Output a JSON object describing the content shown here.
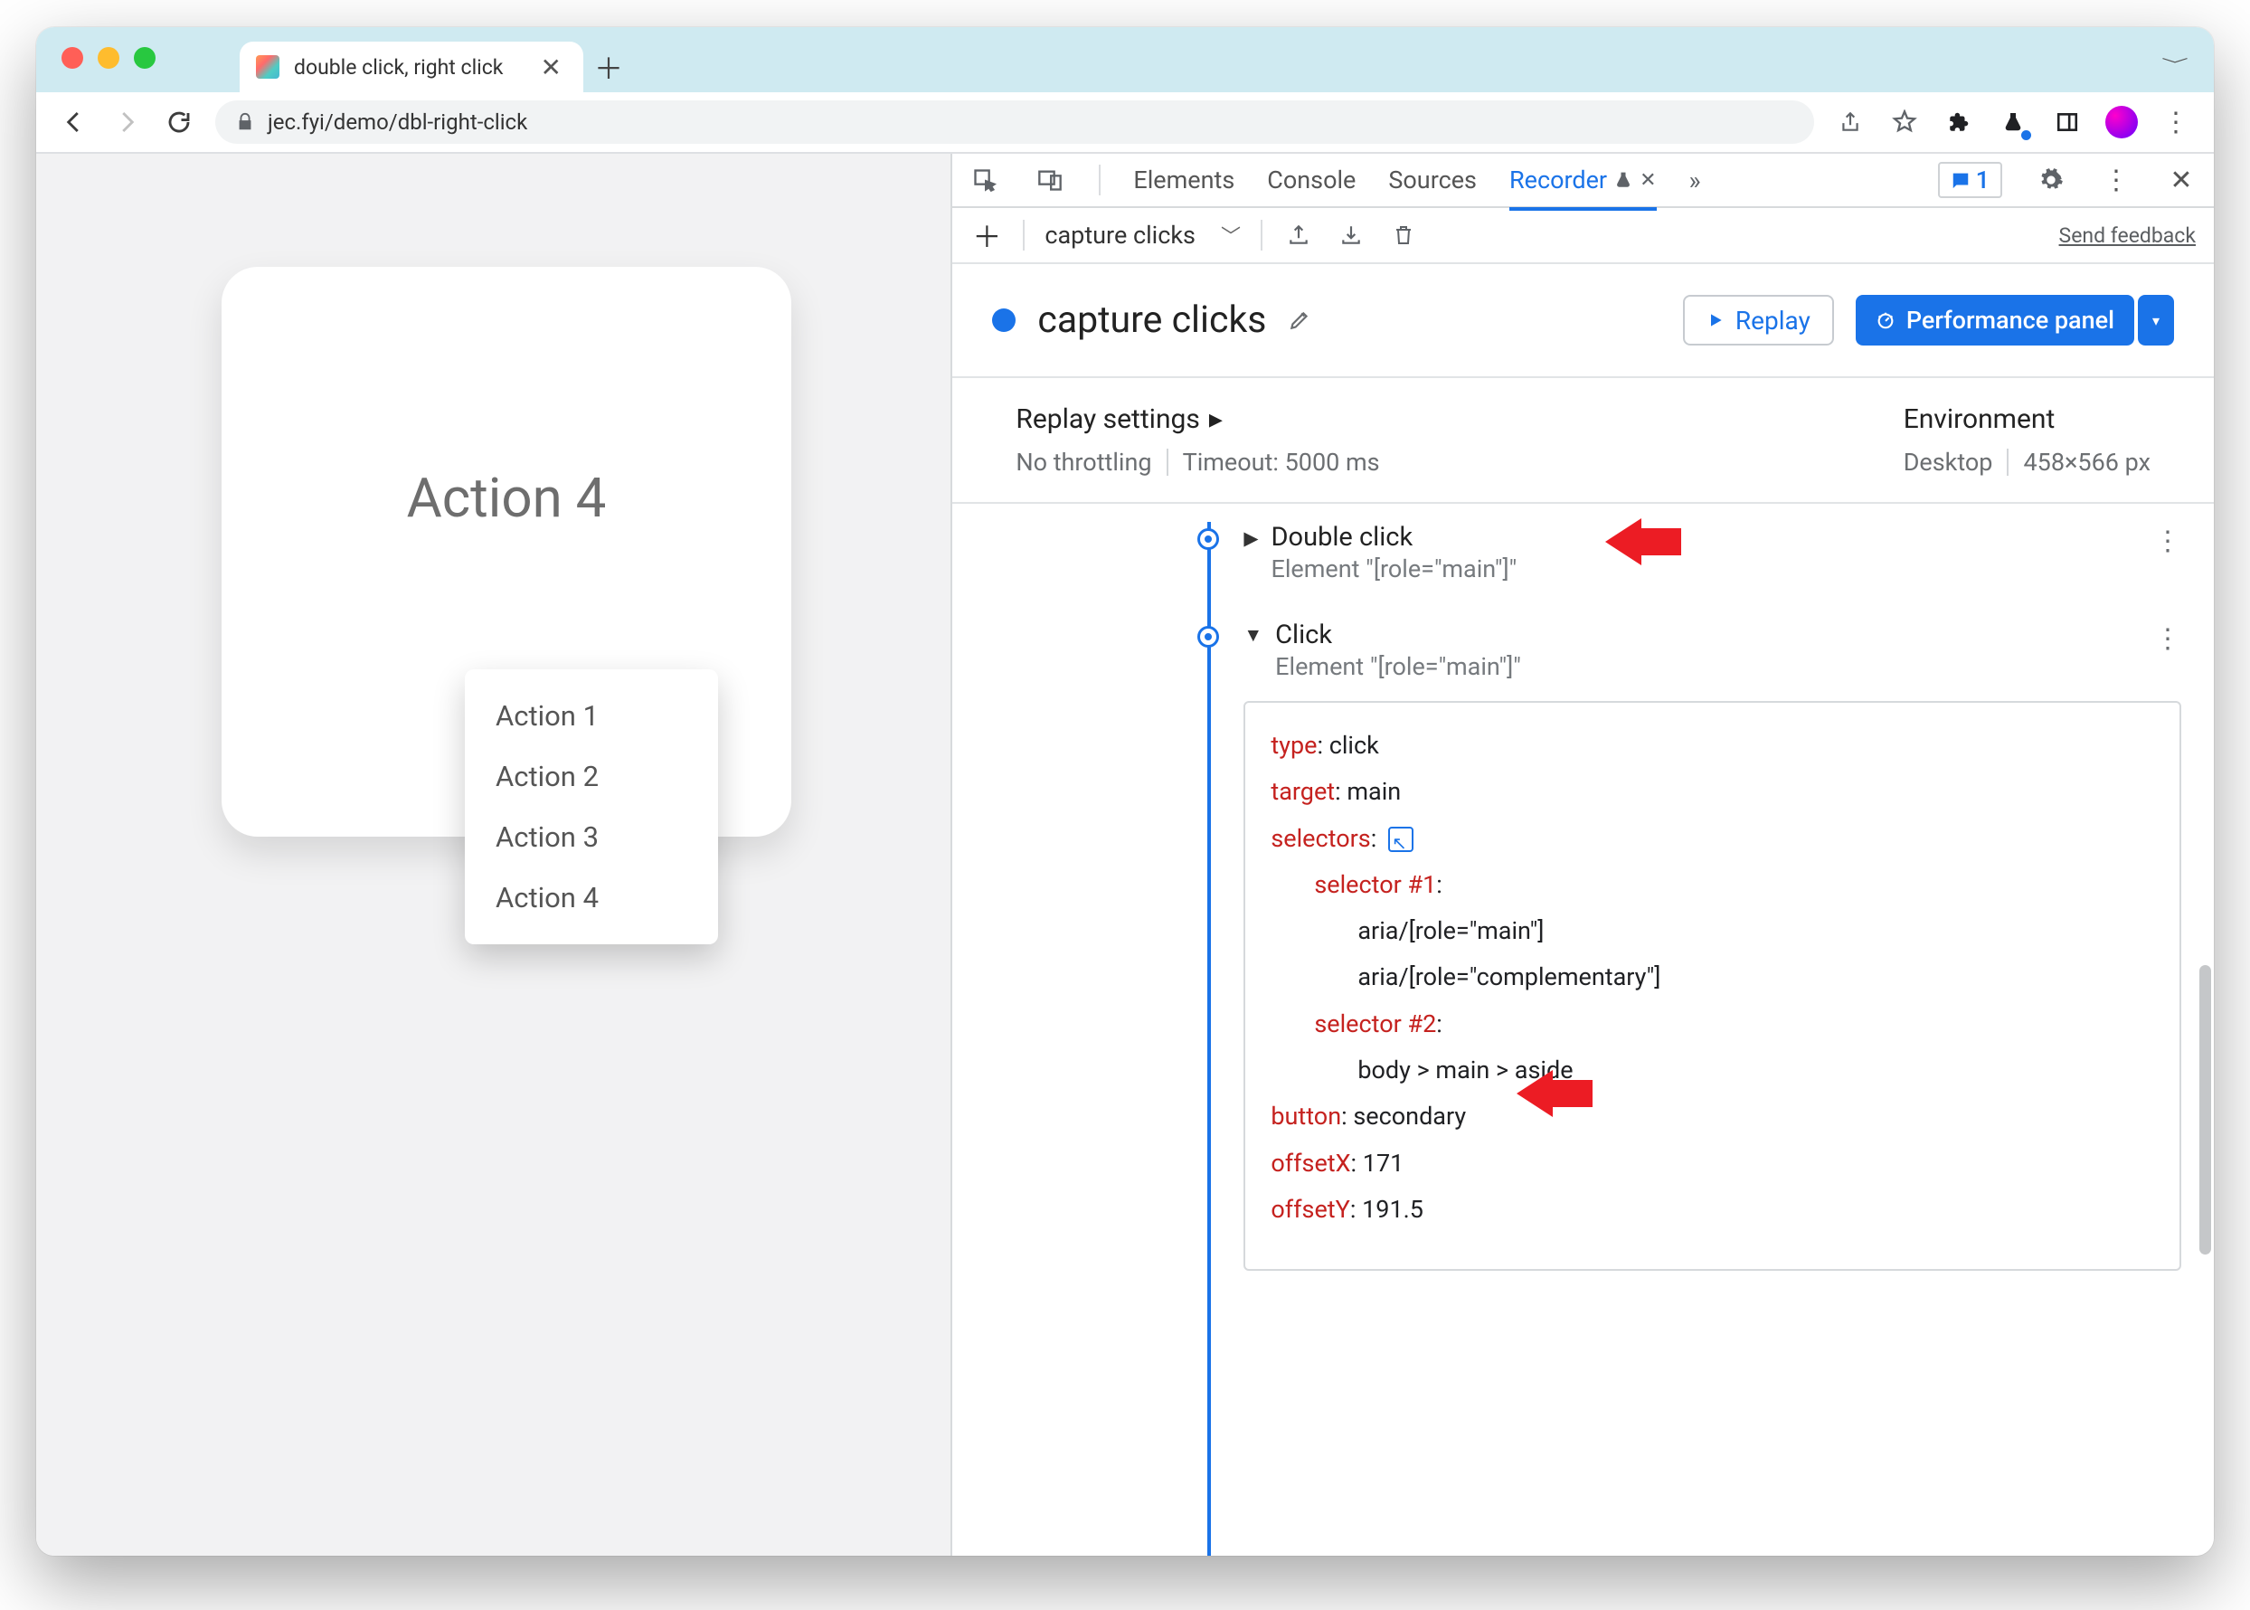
{
  "window": {
    "traffic_colors": [
      "#ff5f57",
      "#febc2e",
      "#28c840"
    ]
  },
  "tab": {
    "title": "double click, right click"
  },
  "toolbar": {
    "url_display": "jec.fyi/demo/dbl-right-click"
  },
  "page": {
    "card_title": "Action 4",
    "context_menu": [
      "Action 1",
      "Action 2",
      "Action 3",
      "Action 4"
    ]
  },
  "devtools": {
    "tabs": [
      "Elements",
      "Console",
      "Sources"
    ],
    "active_tab": "Recorder",
    "issues_count": "1",
    "feedback_link": "Send feedback"
  },
  "recorder": {
    "dropdown_name": "capture clicks",
    "title": "capture clicks",
    "replay_btn": "Replay",
    "perf_btn": "Performance panel",
    "replay_settings_label": "Replay settings",
    "throttling": "No throttling",
    "timeout": "Timeout: 5000 ms",
    "env_label": "Environment",
    "env_device": "Desktop",
    "env_size": "458×566 px"
  },
  "steps": [
    {
      "expanded": false,
      "title": "Double click",
      "subtitle": "Element \"[role=\"main\"]\""
    },
    {
      "expanded": true,
      "title": "Click",
      "subtitle": "Element \"[role=\"main\"]\"",
      "detail": {
        "type": "click",
        "target": "main",
        "selectors_label": "selectors",
        "sel1_label": "selector #1",
        "sel1_lines": [
          "aria/[role=\"main\"]",
          "aria/[role=\"complementary\"]"
        ],
        "sel2_label": "selector #2",
        "sel2_lines": [
          "body > main > aside"
        ],
        "button": "secondary",
        "offsetX": "171",
        "offsetY": "191.5"
      }
    }
  ]
}
